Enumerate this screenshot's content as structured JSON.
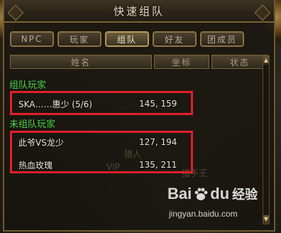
{
  "window": {
    "title": "快速组队"
  },
  "tabs": [
    {
      "label": "NPC",
      "active": false
    },
    {
      "label": "玩家",
      "active": false
    },
    {
      "label": "组队",
      "active": true
    },
    {
      "label": "好友",
      "active": false
    },
    {
      "label": "团成员",
      "active": false
    }
  ],
  "columns": {
    "name": "姓名",
    "coord": "坐标",
    "status": "状态"
  },
  "sections": {
    "grouped": {
      "label": "组队玩家",
      "players": [
        {
          "name": "SKA……惠少 (5/6)",
          "coord": "145, 159"
        }
      ]
    },
    "ungrouped": {
      "label": "未组队玩家",
      "players": [
        {
          "name": "此爷VS龙少",
          "coord": "127, 194"
        },
        {
          "name": "热血玫瑰",
          "coord": "135, 211"
        }
      ]
    }
  },
  "background_text": {
    "a": "猎人",
    "b": "VIP",
    "c": "猎手王"
  },
  "watermark": {
    "logo_left": "Bai",
    "logo_right": "du",
    "suffix": "经验",
    "url": "jingyan.baidu.com"
  },
  "colors": {
    "highlight": "#e0202a",
    "section_label": "#4fd94a",
    "frame": "#7a6232"
  }
}
